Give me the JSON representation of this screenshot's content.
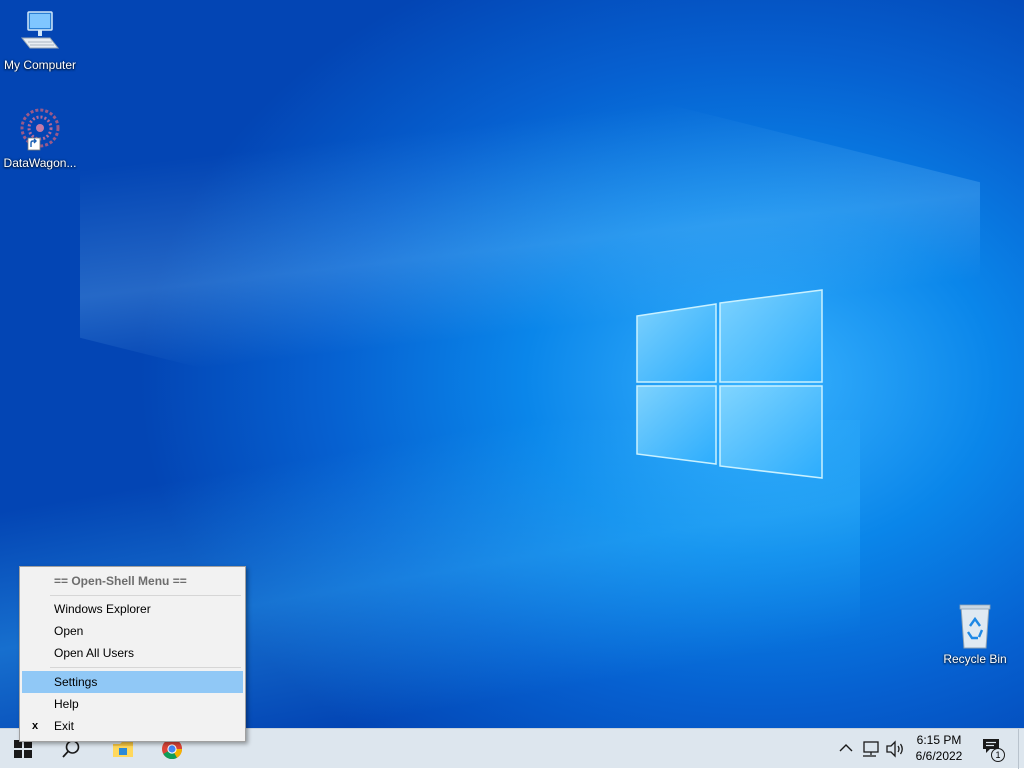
{
  "desktop": {
    "icons": [
      {
        "label": "My Computer"
      },
      {
        "label": "DataWagon..."
      },
      {
        "label": "Recycle Bin"
      }
    ]
  },
  "context_menu": {
    "header": "== Open-Shell Menu ==",
    "items": [
      {
        "label": "Windows Explorer"
      },
      {
        "label": "Open"
      },
      {
        "label": "Open All Users"
      },
      {
        "label": "Settings",
        "highlighted": true
      },
      {
        "label": "Help"
      },
      {
        "label": "Exit",
        "mark": "x"
      }
    ]
  },
  "taskbar": {
    "buttons": [
      {
        "icon": "windows-start-icon"
      },
      {
        "icon": "search-icon"
      },
      {
        "icon": "file-explorer-icon"
      },
      {
        "icon": "chrome-icon"
      }
    ],
    "tray": {
      "icons": [
        "chevron-up-icon",
        "network-icon",
        "volume-icon"
      ],
      "time": "6:15 PM",
      "date": "6/6/2022",
      "notification_count": "1"
    }
  },
  "colors": {
    "desktop_blue": "#0a86ea",
    "menu_highlight": "#90c8f6",
    "taskbar_bg": "#dde6ee"
  }
}
